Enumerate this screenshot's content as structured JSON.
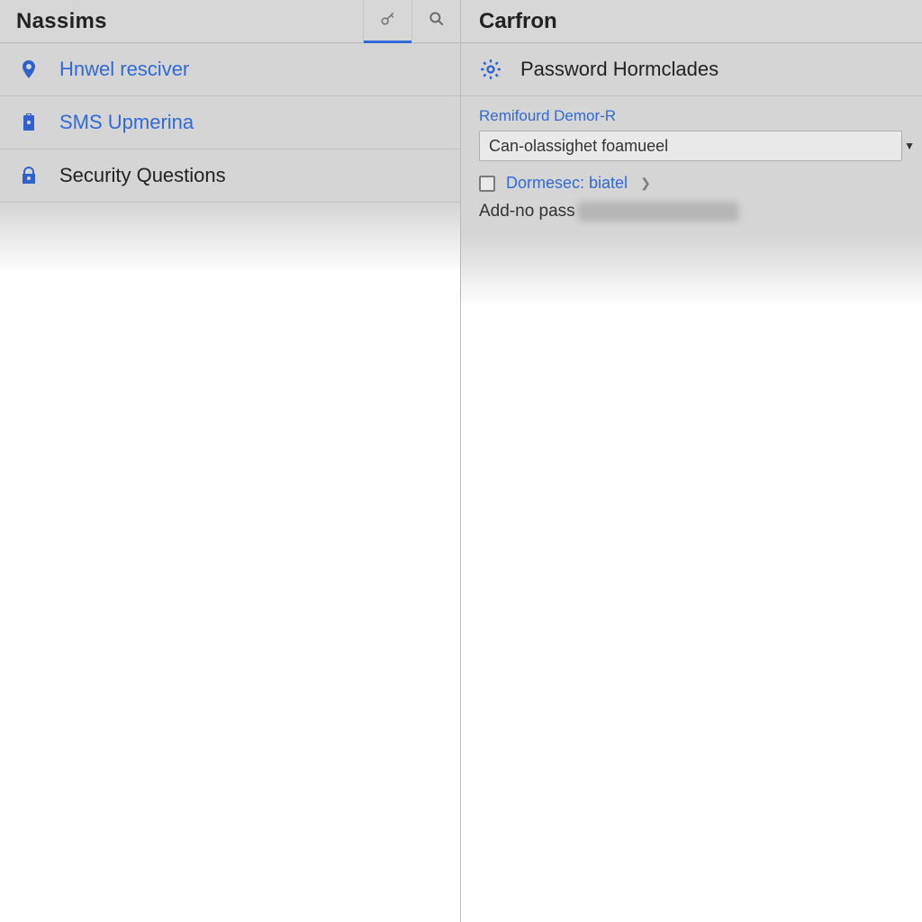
{
  "colors": {
    "accent": "#3169d6",
    "panel": "#d7d7d7",
    "row": "#d5d5d5"
  },
  "left": {
    "title": "Nassims",
    "items": [
      {
        "icon": "pin-icon",
        "label": "Hnwel resciver"
      },
      {
        "icon": "clipboard-icon",
        "label": "SMS Upmerina"
      },
      {
        "icon": "lock-icon",
        "label": "Security Questions"
      }
    ]
  },
  "right": {
    "title": "Carfron",
    "section_title": "Password Hormclades",
    "form": {
      "field_label": "Remifourd Demor-R",
      "select_value": "Can-olassighet foamueel",
      "checkbox_label": "Dormesec: biatel",
      "addno_prefix": "Add-no pass"
    }
  }
}
